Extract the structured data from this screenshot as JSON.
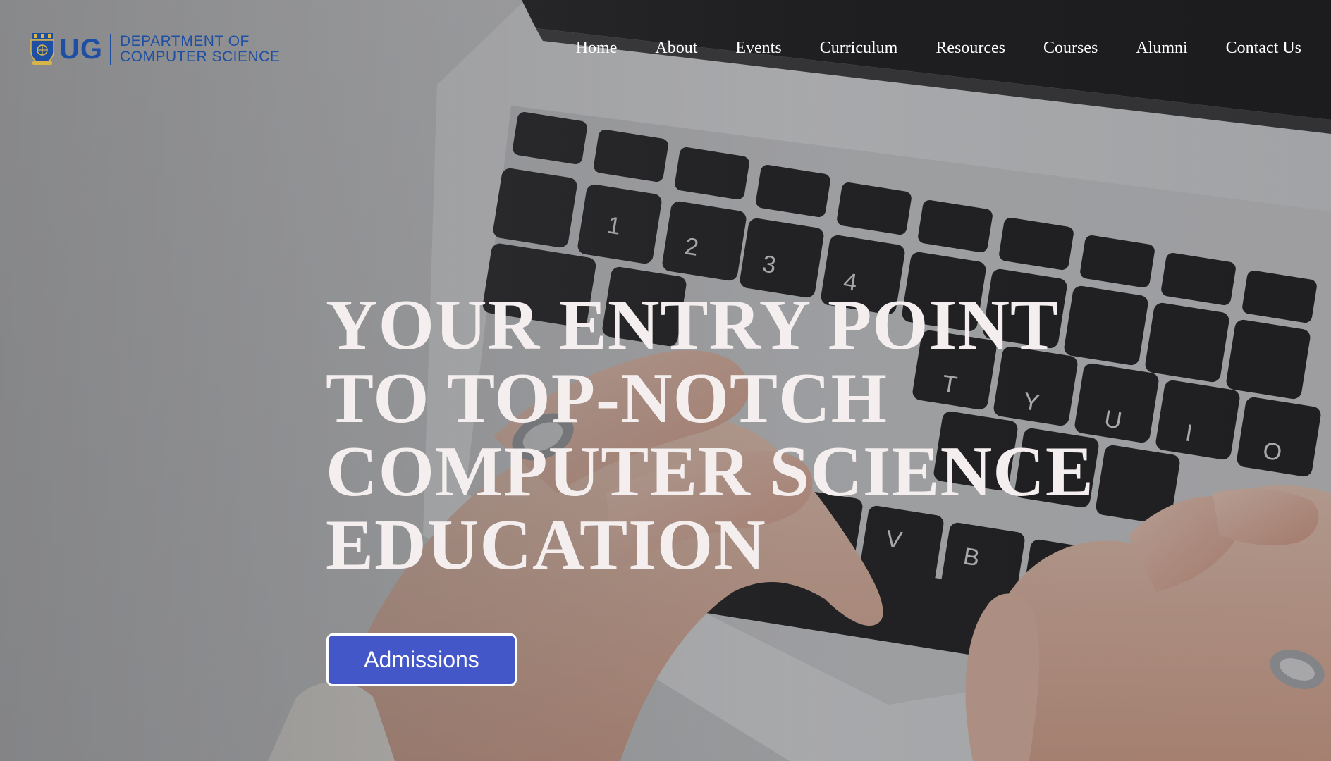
{
  "brand": {
    "logo_letters": "UG",
    "name_line1": "DEPARTMENT OF",
    "name_line2": "COMPUTER SCIENCE",
    "crest_icon": "university-crest-icon",
    "color": "#1f4fa3"
  },
  "nav": {
    "items": [
      {
        "label": "Home"
      },
      {
        "label": "About"
      },
      {
        "label": "Events"
      },
      {
        "label": "Curriculum"
      },
      {
        "label": "Resources"
      },
      {
        "label": "Courses"
      },
      {
        "label": "Alumni"
      },
      {
        "label": "Contact Us"
      }
    ]
  },
  "hero": {
    "headline_line1": "YOUR ENTRY POINT",
    "headline_line2": "TO TOP-NOTCH",
    "headline_line3": "COMPUTER SCIENCE",
    "headline_line4": "EDUCATION",
    "cta_label": "Admissions",
    "cta_color": "#4457c8",
    "background_image": "hands-typing-on-laptop-keyboard"
  }
}
